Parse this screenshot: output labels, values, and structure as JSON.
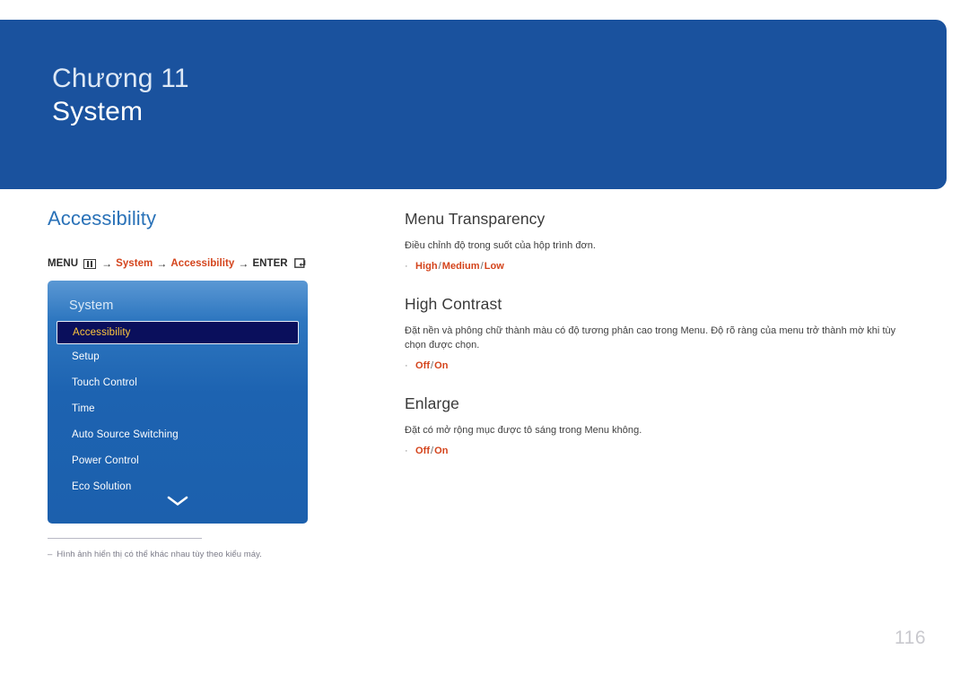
{
  "banner": {
    "chapter_label": "Chương 11",
    "chapter_title": "System",
    "background_color": "#1a529e"
  },
  "left": {
    "section_heading": "Accessibility",
    "heading_color": "#2a72b8",
    "breadcrumb": {
      "menu_label": "MENU",
      "menu_icon": "menu-bars-icon",
      "arrow1": "→",
      "item1": "System",
      "arrow2": "→",
      "item2": "Accessibility",
      "arrow3": "→",
      "enter_label": "ENTER",
      "enter_icon": "enter-return-icon",
      "accent_color": "#d4441c"
    },
    "osd": {
      "title": "System",
      "items": [
        {
          "label": "Accessibility",
          "selected": true
        },
        {
          "label": "Setup",
          "selected": false
        },
        {
          "label": "Touch Control",
          "selected": false
        },
        {
          "label": "Time",
          "selected": false
        },
        {
          "label": "Auto Source Switching",
          "selected": false
        },
        {
          "label": "Power Control",
          "selected": false
        },
        {
          "label": "Eco Solution",
          "selected": false
        }
      ],
      "more_icon": "chevron-down-icon",
      "selected_text_color": "#ffc83d",
      "selected_bg_color": "#0a0f5c"
    },
    "footnote": {
      "dash": "‒",
      "text": "Hình ảnh hiển thị có thể khác nhau tùy theo kiểu máy."
    }
  },
  "right": {
    "topics": [
      {
        "title": "Menu Transparency",
        "description": "Điều chỉnh độ trong suốt của hộp trình đơn.",
        "bullet": "·",
        "options": [
          "High",
          "Medium",
          "Low"
        ],
        "separator": "/"
      },
      {
        "title": "High Contrast",
        "description": "Đặt nền và phông chữ thành màu có độ tương phản cao trong Menu. Độ rõ ràng của menu trở thành mờ khi tùy chọn được chọn.",
        "bullet": "·",
        "options": [
          "Off",
          "On"
        ],
        "separator": "/"
      },
      {
        "title": "Enlarge",
        "description": "Đặt có mở rộng mục được tô sáng trong Menu không.",
        "bullet": "·",
        "options": [
          "Off",
          "On"
        ],
        "separator": "/"
      }
    ]
  },
  "page_number": "116"
}
